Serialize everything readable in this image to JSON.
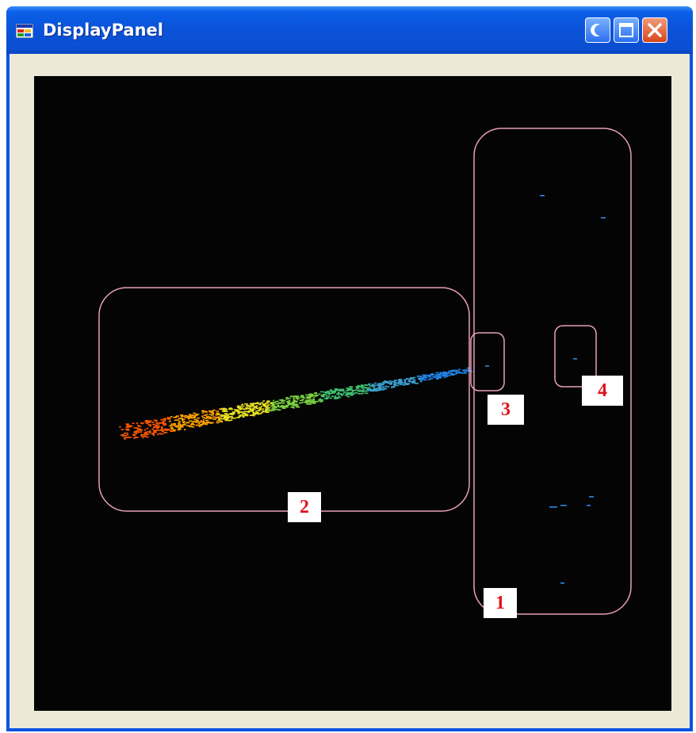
{
  "window": {
    "title": "DisplayPanel",
    "icon": "application-window-icon",
    "controls": [
      "minimize-icon",
      "maximize-icon",
      "close-icon"
    ]
  },
  "display": {
    "background_color": "#040404",
    "region_outline_color": "#e8a0b4",
    "label_text_color": "#e0141e",
    "regions": [
      {
        "id": "1",
        "label": "1"
      },
      {
        "id": "2",
        "label": "2"
      },
      {
        "id": "3",
        "label": "3"
      },
      {
        "id": "4",
        "label": "4"
      }
    ],
    "point_cloud_colors": [
      "#ff5a00",
      "#ffa000",
      "#e8e020",
      "#7ad040",
      "#40c070",
      "#3aa0d0",
      "#2080e0"
    ]
  }
}
